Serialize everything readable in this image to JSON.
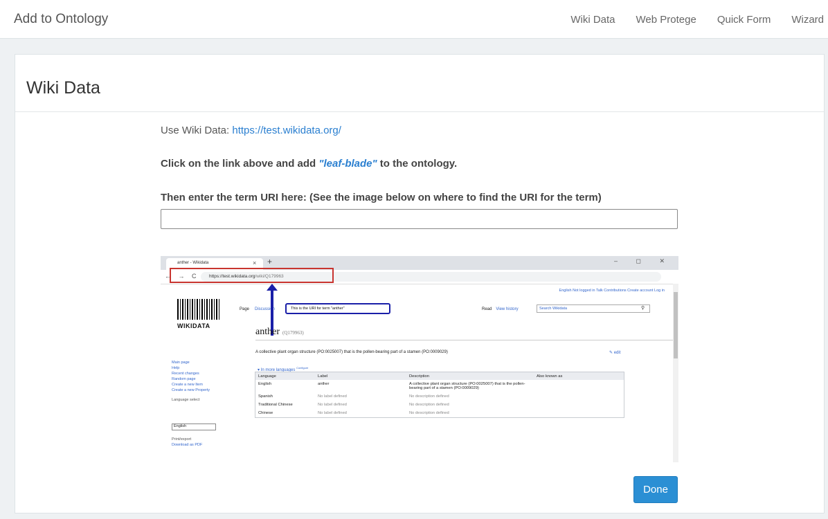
{
  "navbar": {
    "brand": "Add to Ontology",
    "links": [
      "Wiki Data",
      "Web Protege",
      "Quick Form",
      "Wizard"
    ]
  },
  "panel": {
    "title": "Wiki Data",
    "use_prefix": "Use Wiki Data: ",
    "use_link": "https://test.wikidata.org/",
    "instruction_prefix": "Click on the link above and add ",
    "instruction_term": "\"leaf-blade\"",
    "instruction_suffix": " to the ontology.",
    "enter_label": "Then enter the term URI here: (See the image below on where to find the URI for the term)",
    "uri_value": "",
    "done_label": "Done"
  },
  "screenshot": {
    "tab_title": "anther - Wikidata",
    "tab_close": "×",
    "new_tab": "+",
    "window_controls": "– ◻ ✕",
    "nav_arrows": "← → C",
    "url_host": "https://test.wikidata.org",
    "url_path": "/wiki/Q179963",
    "top_right": "English  Not logged in  Talk  Contributions  Create account  Log in",
    "logo_text": "WIKIDATA",
    "sidebar_links": [
      "Main page",
      "Help",
      "Recent changes",
      "Random page",
      "Create a new Item",
      "Create a new Property"
    ],
    "sidebar_language_label": "Language select",
    "sidebar_language_value": "English",
    "sidebar_print_label": "Print/export",
    "sidebar_download": "Download as PDF",
    "page_tab": "Page",
    "discussion_tab": "Discussion",
    "uri_hint": "This is the URI for term \"anther\"",
    "read_tab": "Read",
    "view_history_tab": "View history",
    "search_placeholder": "Search Wikidata",
    "item_label": "anther",
    "item_id": "(Q179963)",
    "item_description": "A collective plant organ structure (PO:0025007) that is the pollen-bearing part of a stamen (PO:0009029)",
    "edit": "edit",
    "more_languages": "In more languages",
    "configure": "Configure",
    "table_headers": [
      "Language",
      "Label",
      "Description",
      "Also known as"
    ],
    "table_rows": [
      [
        "English",
        "anther",
        "A collective plant organ structure (PO:0025007) that is the pollen-bearing part of a stamen (PO:0009029)",
        ""
      ],
      [
        "Spanish",
        "No label defined",
        "No description defined",
        ""
      ],
      [
        "Traditional Chinese",
        "No label defined",
        "No description defined",
        ""
      ],
      [
        "Chinese",
        "No label defined",
        "No description defined",
        ""
      ]
    ]
  }
}
